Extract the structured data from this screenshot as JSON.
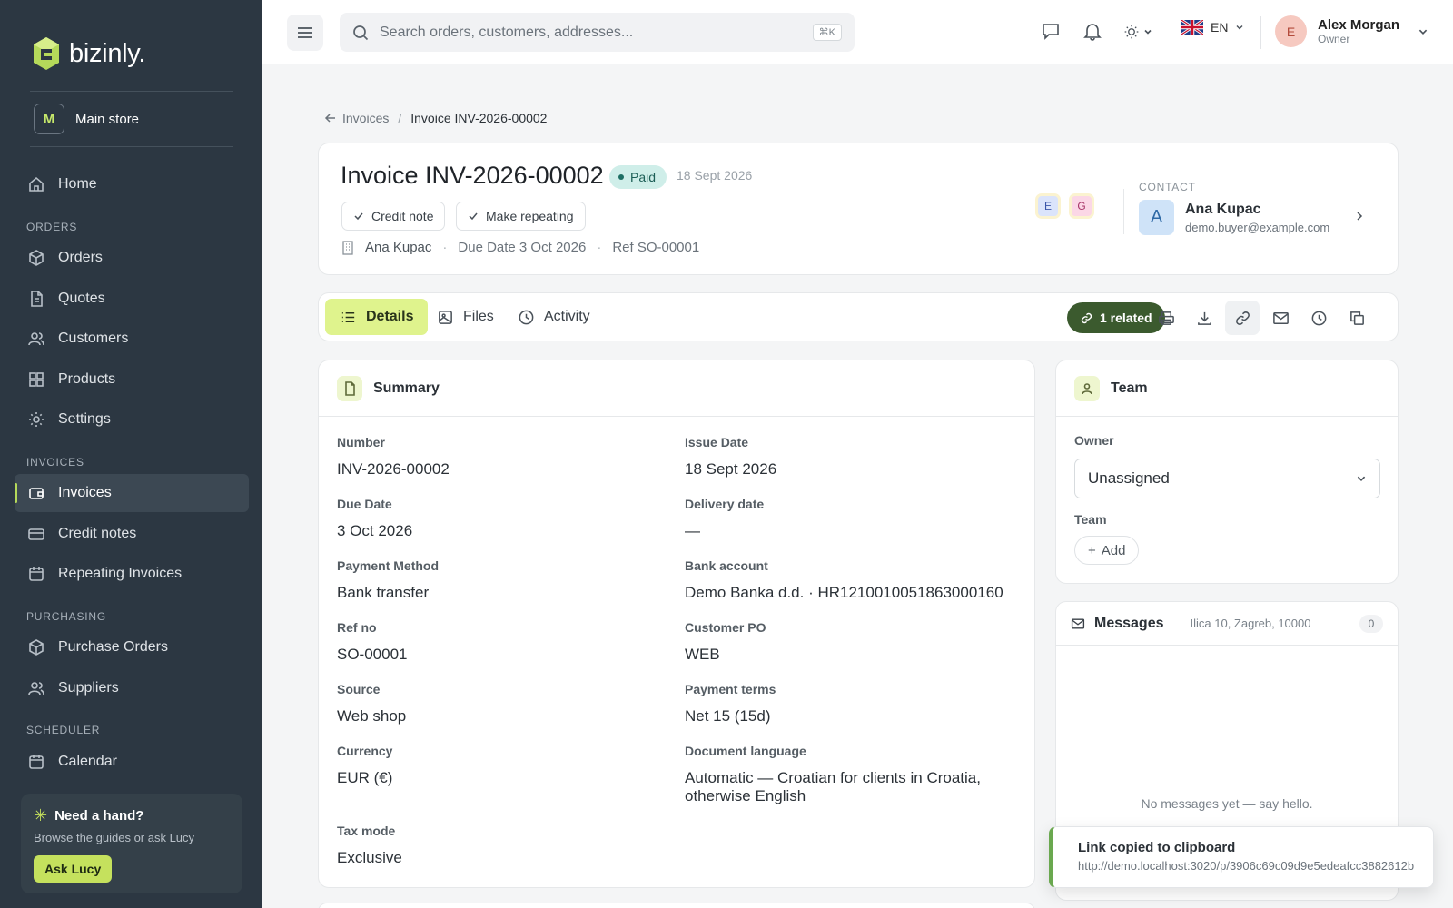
{
  "brand": {
    "name": "bizinly.",
    "accent": "#c5e15d"
  },
  "store": {
    "initial": "M",
    "name": "Main store"
  },
  "sidebar": {
    "home": "Home",
    "sections": {
      "orders": "ORDERS",
      "invoices": "INVOICES",
      "purchasing": "PURCHASING",
      "scheduler": "SCHEDULER"
    },
    "orders_items": [
      "Orders",
      "Quotes",
      "Customers",
      "Products",
      "Settings"
    ],
    "invoices_items": [
      "Invoices",
      "Credit notes",
      "Repeating Invoices"
    ],
    "purchasing_items": [
      "Purchase Orders",
      "Suppliers"
    ],
    "scheduler_items": [
      "Calendar"
    ],
    "active": "Invoices"
  },
  "help": {
    "title": "Need a hand?",
    "subtitle": "Browse the guides or ask Lucy",
    "button": "Ask Lucy"
  },
  "search": {
    "placeholder": "Search orders, customers, addresses...",
    "shortcut": "⌘K"
  },
  "topbar": {
    "language": "EN"
  },
  "user": {
    "initial": "E",
    "name": "Alex Morgan",
    "role": "Owner"
  },
  "breadcrumb": {
    "parent": "Invoices",
    "separator": "/",
    "current": "Invoice INV-2026-00002"
  },
  "invoice": {
    "title": "Invoice INV-2026-00002",
    "status": "Paid",
    "date": "18 Sept 2026",
    "chips": [
      "Credit note",
      "Make repeating"
    ],
    "customer": "Ana Kupac",
    "due": "Due Date 3 Oct 2026",
    "ref": "Ref SO-00001",
    "assignees": [
      "E",
      "G"
    ]
  },
  "contact": {
    "label": "CONTACT",
    "initial": "A",
    "name": "Ana Kupac",
    "email": "demo.buyer@example.com"
  },
  "tabs": [
    "Details",
    "Files",
    "Activity"
  ],
  "related": "1 related",
  "summary": {
    "title": "Summary",
    "fields": [
      {
        "label": "Number",
        "value": "INV-2026-00002"
      },
      {
        "label": "Issue Date",
        "value": "18 Sept 2026"
      },
      {
        "label": "Due Date",
        "value": "3 Oct 2026"
      },
      {
        "label": "Delivery date",
        "value": "—"
      },
      {
        "label": "Payment Method",
        "value": "Bank transfer"
      },
      {
        "label": "Bank account",
        "value": "Demo Banka d.d. · HR1210010051863000160"
      },
      {
        "label": "Ref no",
        "value": "SO-00001"
      },
      {
        "label": "Customer PO",
        "value": "WEB"
      },
      {
        "label": "Source",
        "value": "Web shop"
      },
      {
        "label": "Payment terms",
        "value": "Net 15 (15d)"
      },
      {
        "label": "Currency",
        "value": "EUR (€)"
      },
      {
        "label": "Document language",
        "value": "Automatic — Croatian for clients in Croatia, otherwise English"
      },
      {
        "label": "Tax mode",
        "value": "Exclusive"
      }
    ]
  },
  "team": {
    "title": "Team",
    "owner_label": "Owner",
    "owner_value": "Unassigned",
    "team_label": "Team",
    "add": "Add"
  },
  "messages": {
    "title": "Messages",
    "address": "Ilica 10, Zagreb, 10000",
    "count": "0",
    "empty": "No messages yet — say hello."
  },
  "toast": {
    "title": "Link copied to clipboard",
    "url": "http://demo.localhost:3020/p/3906c69c09d9e5edeafcc3882612b"
  }
}
